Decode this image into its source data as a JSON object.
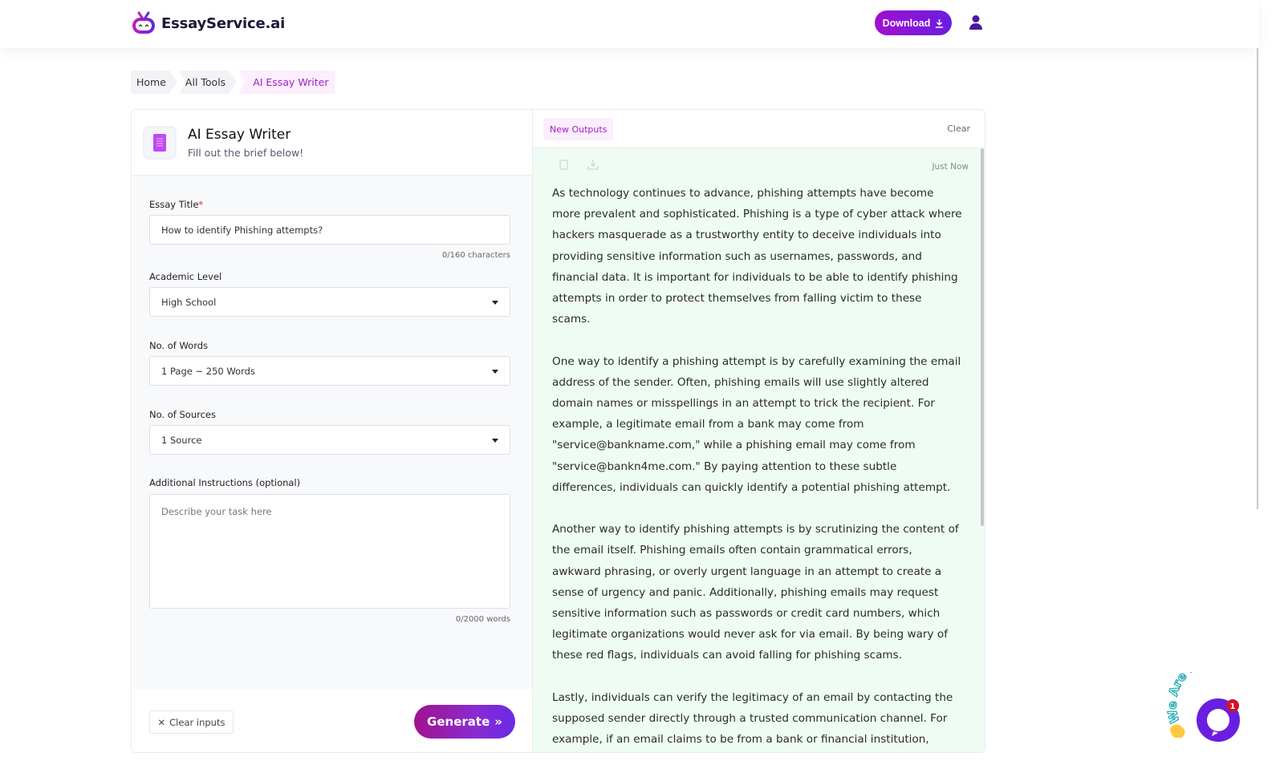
{
  "header": {
    "brand": "EssayService.ai",
    "download_label": "Download"
  },
  "breadcrumb": [
    "Home",
    "All Tools",
    "AI Essay Writer"
  ],
  "tool": {
    "title": "AI Essay Writer",
    "subtitle": "Fill out the brief below!"
  },
  "form": {
    "essay_title_label": "Essay Title",
    "required_mark": "*",
    "essay_title_value": "How to identify Phishing attempts?",
    "title_count": "0/160 characters",
    "academic_level_label": "Academic Level",
    "academic_level_value": "High School",
    "words_label": "No. of Words",
    "words_value": "1 Page ~ 250 Words",
    "sources_label": "No. of Sources",
    "sources_value": "1 Source",
    "instructions_label": "Additional Instructions (optional)",
    "instructions_placeholder": "Describe your task here",
    "instructions_count": "0/2000 words",
    "clear_label": "Clear inputs",
    "generate_label": "Generate"
  },
  "output": {
    "tab_label": "New Outputs",
    "clear_label": "Clear",
    "timestamp": "Just Now",
    "paragraphs": [
      "As technology continues to advance, phishing attempts have become more prevalent and sophisticated. Phishing is a type of cyber attack where hackers masquerade as a trustworthy entity to deceive individuals into providing sensitive information such as usernames, passwords, and financial data. It is important for individuals to be able to identify phishing attempts in order to protect themselves from falling victim to these scams.",
      "One way to identify a phishing attempt is by carefully examining the email address of the sender. Often, phishing emails will use slightly altered domain names or misspellings in an attempt to trick the recipient. For example, a legitimate email from a bank may come from \"service@bankname.com,\" while a phishing email may come from \"service@bankn4me.com.\" By paying attention to these subtle differences, individuals can quickly identify a potential phishing attempt.",
      "Another way to identify phishing attempts is by scrutinizing the content of the email itself. Phishing emails often contain grammatical errors, awkward phrasing, or overly urgent language in an attempt to create a sense of urgency and panic. Additionally, phishing emails may request sensitive information such as passwords or credit card numbers, which legitimate organizations would never ask for via email. By being wary of these red flags, individuals can avoid falling for phishing scams.",
      "Lastly, individuals can verify the legitimacy of an email by contacting the supposed sender directly through a trusted communication channel. For example, if an email claims to be from a bank or financial institution, individuals can call the customer service number provided on the official"
    ]
  },
  "chat_widget": {
    "text": "We Are Here!",
    "badge": "1"
  },
  "colors": {
    "brand_purple": "#a020c8",
    "output_bg": "#effcf3"
  }
}
